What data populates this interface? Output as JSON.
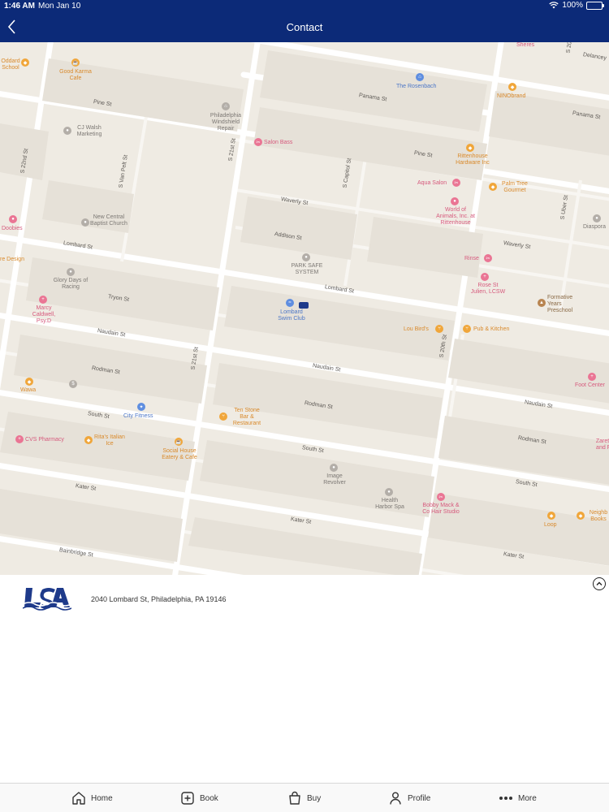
{
  "status_bar": {
    "time": "1:46 AM",
    "date": "Mon Jan 10",
    "battery": "100%"
  },
  "header": {
    "title": "Contact"
  },
  "map": {
    "streets": [
      "Pine St",
      "Pine St",
      "Panama St",
      "Panama St",
      "Delancey",
      "Waverly St",
      "Waverly St",
      "Addison St",
      "Lombard St",
      "Lombard St",
      "Tryon St",
      "Naudain St",
      "Naudain St",
      "Naudain St",
      "Rodman St",
      "Rodman St",
      "Rodman St",
      "South St",
      "South St",
      "South St",
      "Kater St",
      "Kater St",
      "Kater St",
      "Bainbridge St",
      "S 22nd St",
      "S Van Pelt St",
      "S 21st St",
      "S 21st St",
      "S Capitol St",
      "S 20th St",
      "S Uber St",
      "S 20th St"
    ],
    "places": [
      "Good Karma Cafe",
      "The Rosenbach",
      "NINObrand",
      "Philadelphia Windshield Repair",
      "CJ Walsh Marketing",
      "Salon Bass",
      "Rittenhouse Hardware Inc",
      "Aqua Salon",
      "Palm Tree Gourmet",
      "World of Animals, Inc. at Rittenhouse",
      "New Central Baptist Church",
      "Diaspora",
      "Doobies",
      "PARK SAFE SYSTEM",
      "Rinse",
      "Glory Days of Racing",
      "Rose St Julien, LCSW",
      "Marcy Caldwell, Psy.D",
      "Formative Years Preschool",
      "Lombard Swim Club",
      "Lou Bird's",
      "Pub & Kitchen",
      "Wawa",
      "Foot Center",
      "City Fitness",
      "Ten Stone Bar & Restaurant",
      "CVS Pharmacy",
      "Rita's Italian Ice",
      "Social House Eatery & Cafe",
      "Zarett and F",
      "Image Revolver",
      "Health Harbor Spa",
      "Bobby Mack & Co Hair Studio",
      "Loop",
      "Neighb Books",
      "Oddard School",
      "re Design",
      "Sheres"
    ]
  },
  "contact": {
    "address": "2040 Lombard St, Philadelphia, PA 19146"
  },
  "tabs": [
    {
      "label": "Home",
      "icon": "home-icon"
    },
    {
      "label": "Book",
      "icon": "plus-square-icon"
    },
    {
      "label": "Buy",
      "icon": "shopping-bag-icon"
    },
    {
      "label": "Profile",
      "icon": "person-icon"
    },
    {
      "label": "More",
      "icon": "more-dots-icon"
    }
  ],
  "colors": {
    "header": "#0c2a78",
    "map_bg": "#efebe3",
    "road": "#ffffff",
    "block": "#e4dfd6"
  }
}
